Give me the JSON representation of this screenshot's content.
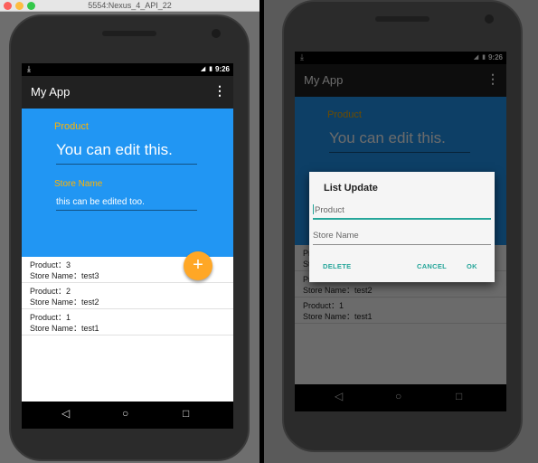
{
  "window": {
    "title": "5554:Nexus_4_API_22"
  },
  "status_bar": {
    "time": "9:26"
  },
  "app": {
    "title": "My App",
    "menu_icon": "more-vert-icon"
  },
  "form": {
    "product_label": "Product",
    "product_value": "You can edit this.",
    "store_label": "Store Name",
    "store_value": "this can be edited too."
  },
  "list": {
    "items": [
      {
        "product": "Product：3",
        "store": "Store Name：test3"
      },
      {
        "product": "Product：2",
        "store": "Store Name：test2"
      },
      {
        "product": "Product：1",
        "store": "Store Name：test1"
      }
    ]
  },
  "fab": {
    "label": "+",
    "color": "#ffa726"
  },
  "nav": {
    "back": "◁",
    "home": "○",
    "recents": "□"
  },
  "dialog": {
    "title": "List Update",
    "product_placeholder": "Product",
    "store_placeholder": "Store Name",
    "delete_label": "DELETE",
    "cancel_label": "CANCEL",
    "ok_label": "OK"
  },
  "colors": {
    "primary": "#2196f3",
    "accent": "#ffb300",
    "dialog_accent": "#26a69a",
    "appbar": "#212121"
  }
}
